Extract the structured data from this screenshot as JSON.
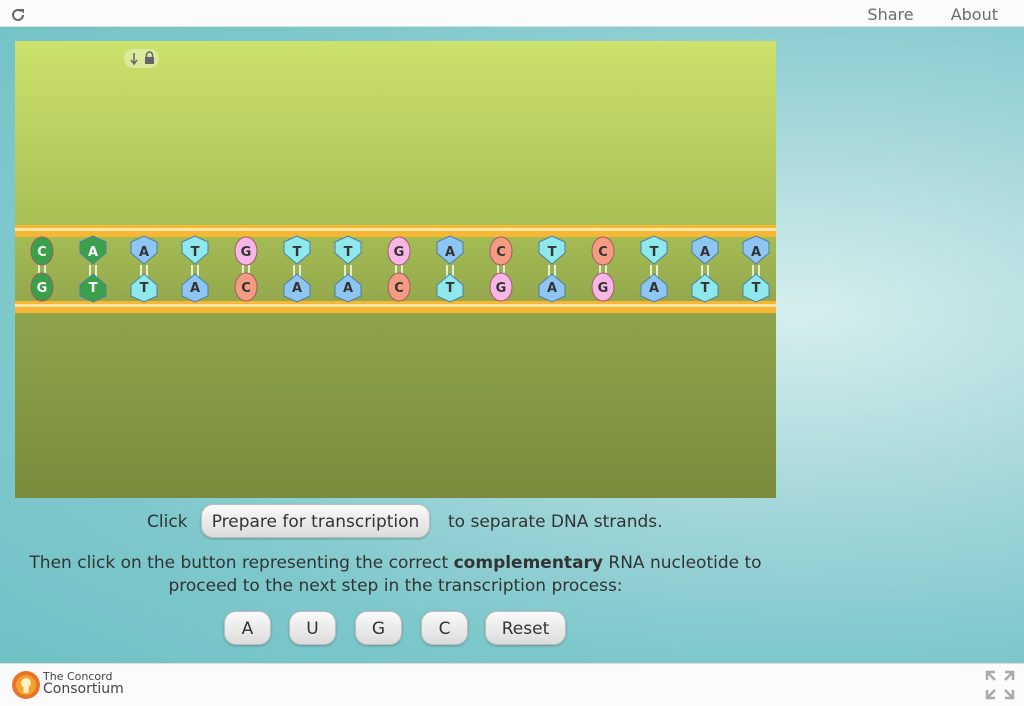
{
  "header": {
    "share_label": "Share",
    "about_label": "About"
  },
  "instructions": {
    "click_text": "Click",
    "prepare_button": "Prepare for transcription",
    "after_text": "to separate DNA strands.",
    "line_part1": "Then click on the button representing the correct ",
    "line_bold": "complementary",
    "line_part2": " RNA nucleotide to proceed to the next step in the transcription process:"
  },
  "nucleotide_buttons": [
    "A",
    "U",
    "G",
    "C"
  ],
  "reset_label": "Reset",
  "dna": {
    "top_strand": [
      "C",
      "A",
      "A",
      "T",
      "G",
      "T",
      "T",
      "G",
      "A",
      "C",
      "T",
      "C",
      "T",
      "A",
      "A"
    ],
    "bottom_strand": [
      "G",
      "T",
      "T",
      "A",
      "C",
      "A",
      "A",
      "C",
      "T",
      "G",
      "A",
      "G",
      "A",
      "T",
      "T"
    ]
  },
  "colors": {
    "A": "#8ec5f2",
    "T": "#8ee8ec",
    "G": "#f7b6e6",
    "C": "#f39c82",
    "first_pair": "#3aa04a",
    "backbone": "#f7b733"
  },
  "footer": {
    "logo_line1": "The Concord",
    "logo_line2": "Consortium"
  }
}
